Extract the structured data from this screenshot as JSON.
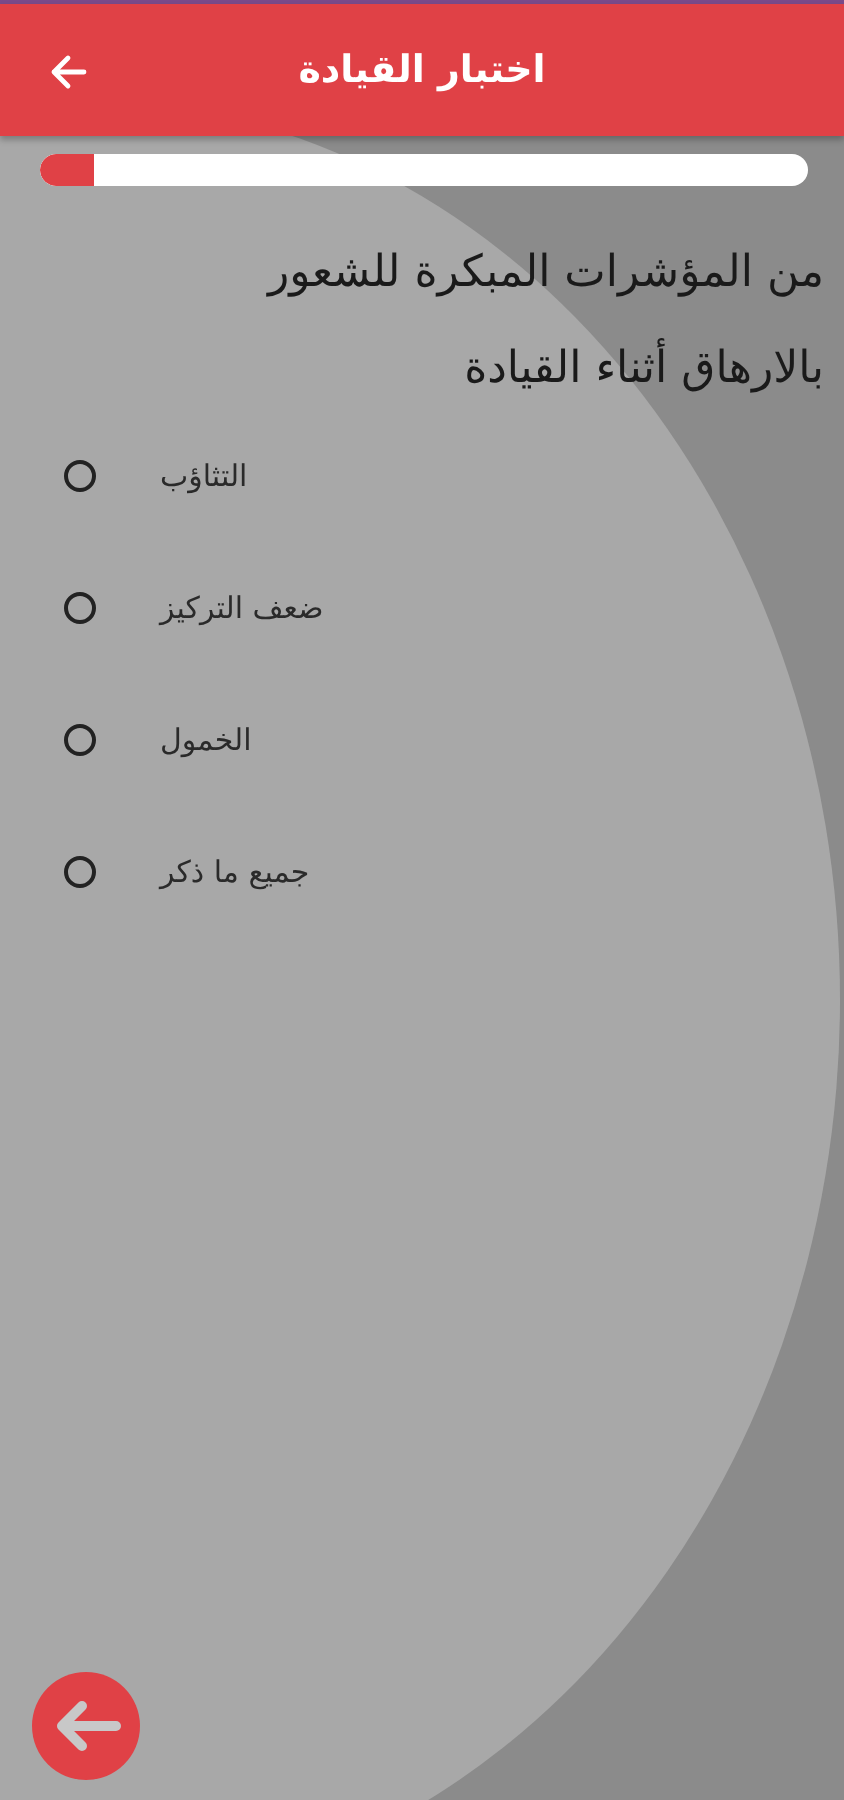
{
  "header": {
    "title": "اختبار القيادة"
  },
  "progress": {
    "level": 0.07
  },
  "question": "من المؤشرات المبكرة للشعور بالارهاق أثناء  القيادة",
  "options": [
    {
      "label": "التثاؤب",
      "selected": false
    },
    {
      "label": "ضعف التركيز",
      "selected": false
    },
    {
      "label": "الخمول",
      "selected": false
    },
    {
      "label": "جميع ما ذكر",
      "selected": false
    }
  ]
}
